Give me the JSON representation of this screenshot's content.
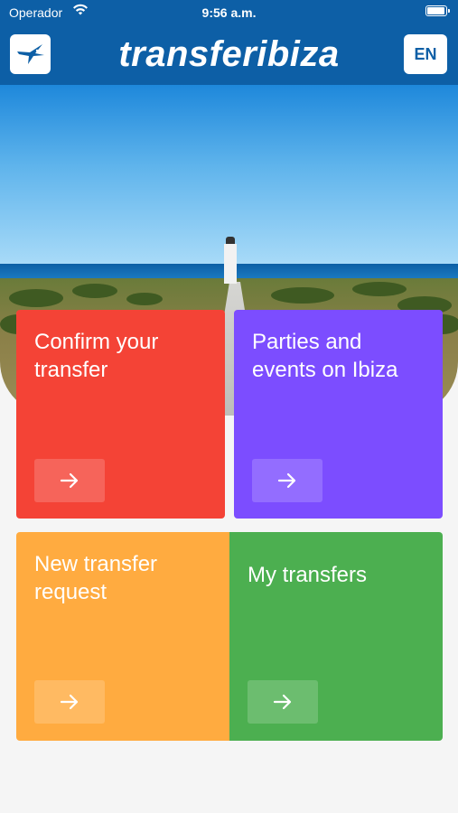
{
  "status_bar": {
    "carrier": "Operador",
    "time": "9:56 a.m.",
    "battery_level": 1.0
  },
  "header": {
    "brand": "transferibiza",
    "language": "EN",
    "logo_icon": "bird-icon",
    "background_color": "#0d5fa6"
  },
  "tiles": [
    {
      "title": "Confirm your transfer",
      "color": "#f44336",
      "icon": "arrow-right-icon"
    },
    {
      "title": "Parties and events on Ibiza",
      "color": "#7c4dff",
      "icon": "arrow-right-icon"
    },
    {
      "title": "New transfer request",
      "color": "#ffab40",
      "icon": "arrow-right-icon"
    },
    {
      "title": "My transfers",
      "color": "#4caf50",
      "icon": "arrow-right-icon"
    }
  ]
}
